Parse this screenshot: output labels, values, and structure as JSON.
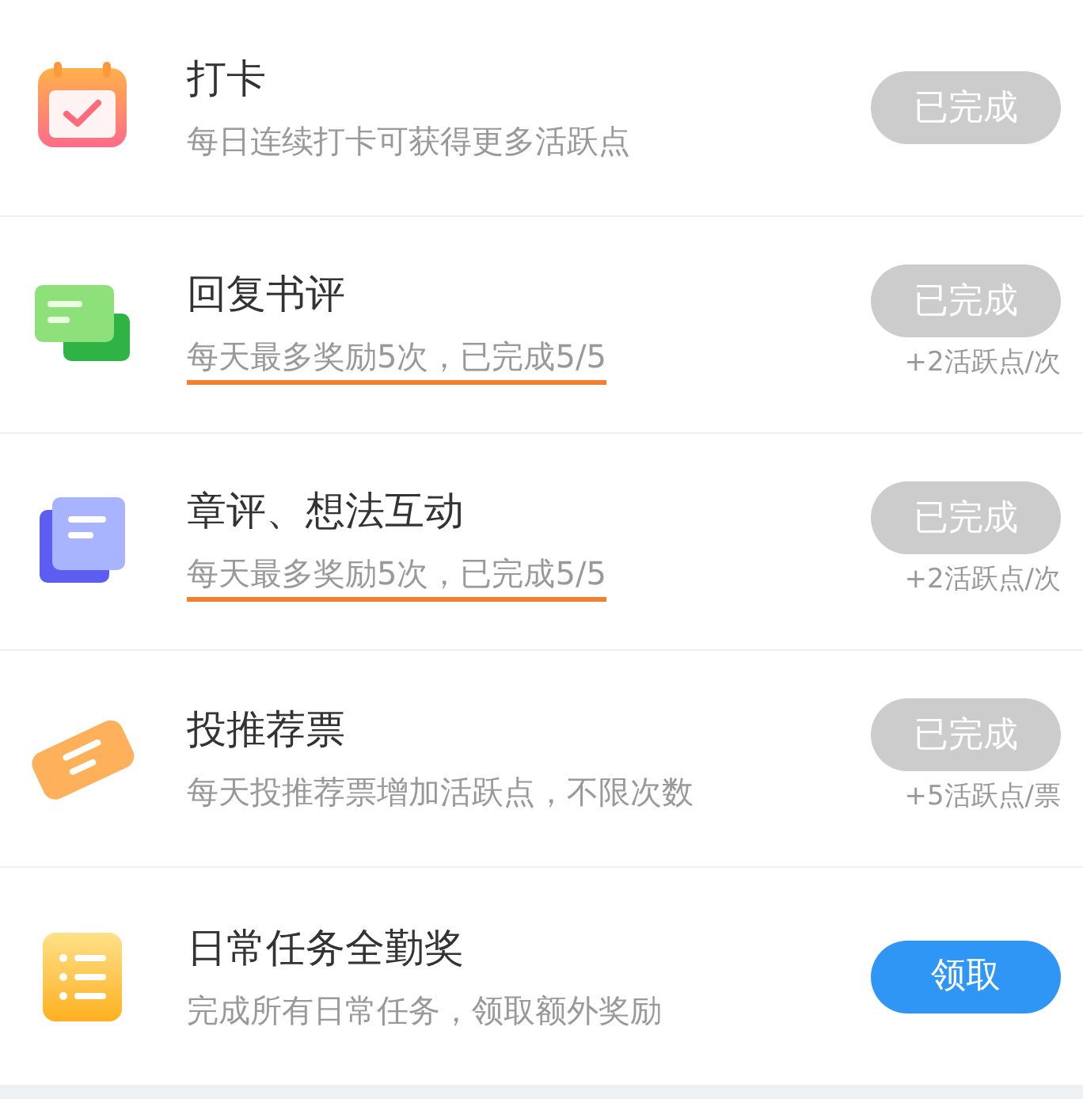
{
  "tasks": [
    {
      "kind": "calendar",
      "title": "打卡",
      "subtitle": "每日连续打卡可获得更多活跃点",
      "underlined": false,
      "button": {
        "label": "已完成",
        "done": true
      }
    },
    {
      "kind": "chat",
      "title": "回复书评",
      "subtitle": "每天最多奖励5次，已完成5/5",
      "underlined": true,
      "button": {
        "label": "已完成",
        "done": true
      },
      "reward": "+2活跃点/次"
    },
    {
      "kind": "document",
      "title": "章评、想法互动",
      "subtitle": "每天最多奖励5次，已完成5/5",
      "underlined": true,
      "button": {
        "label": "已完成",
        "done": true
      },
      "reward": "+2活跃点/次"
    },
    {
      "kind": "ticket",
      "title": "投推荐票",
      "subtitle": "每天投推荐票增加活跃点，不限次数",
      "underlined": false,
      "button": {
        "label": "已完成",
        "done": true
      },
      "reward": "+5活跃点/票"
    },
    {
      "kind": "list",
      "title": "日常任务全勤奖",
      "subtitle": "完成所有日常任务，领取额外奖励",
      "underlined": false,
      "button": {
        "label": "领取",
        "done": false
      }
    }
  ]
}
